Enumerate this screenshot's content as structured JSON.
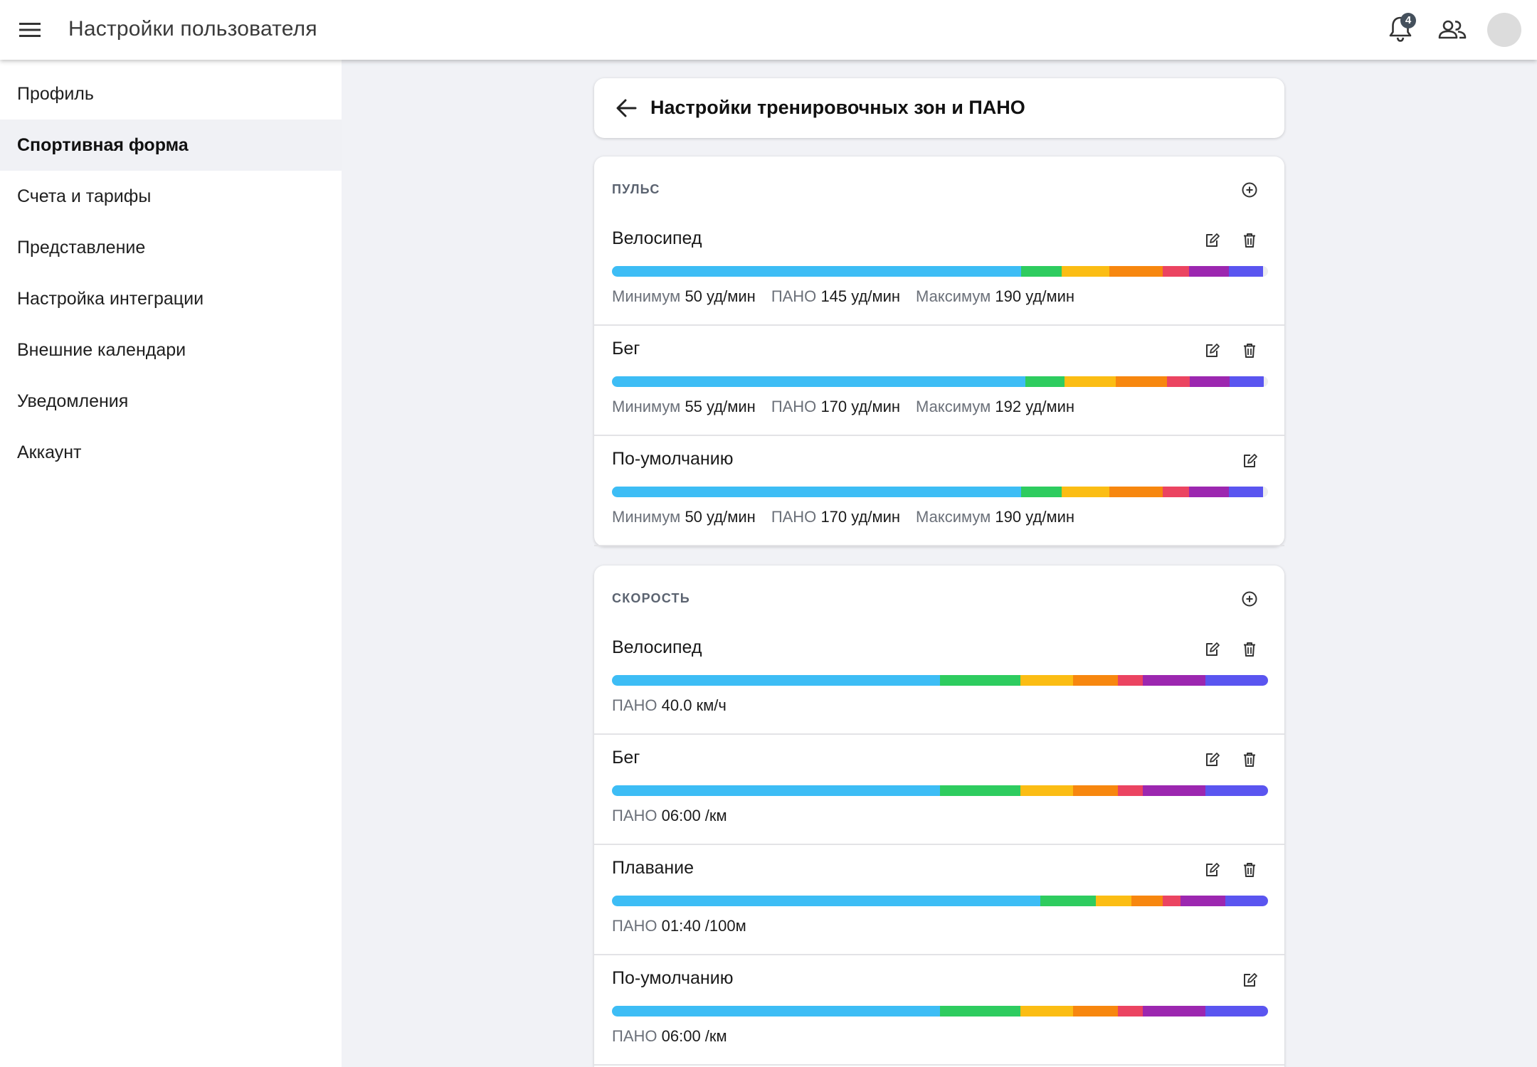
{
  "topbar": {
    "title": "Настройки пользователя",
    "notifications_count": "4"
  },
  "sidebar": {
    "items": [
      {
        "label": "Профиль",
        "active": false
      },
      {
        "label": "Спортивная форма",
        "active": true
      },
      {
        "label": "Счета и тарифы",
        "active": false
      },
      {
        "label": "Представление",
        "active": false
      },
      {
        "label": "Настройка интеграции",
        "active": false
      },
      {
        "label": "Внешние календари",
        "active": false
      },
      {
        "label": "Уведомления",
        "active": false
      },
      {
        "label": "Аккаунт",
        "active": false
      }
    ]
  },
  "page": {
    "title": "Настройки тренировочных зон и ПАНО"
  },
  "zone_colors": [
    "#3dbdf5",
    "#2ecc5f",
    "#fbbd14",
    "#f7870f",
    "#eb4461",
    "#9c27b0",
    "#5a55f0"
  ],
  "labels": {
    "min": "Минимум",
    "pano": "ПАНО",
    "max": "Максимум"
  },
  "pulse": {
    "title": "ПУЛЬС",
    "rows": [
      {
        "name": "Велосипед",
        "deletable": true,
        "min": "50 уд/мин",
        "pano": "145 уд/мин",
        "max": "190 уд/мин",
        "zones": [
          62.4,
          6.1,
          7.3,
          8.2,
          4.0,
          6.0,
          5.2
        ]
      },
      {
        "name": "Бег",
        "deletable": true,
        "min": "55 уд/мин",
        "pano": "170 уд/мин",
        "max": "192 уд/мин",
        "zones": [
          63.0,
          6.0,
          7.8,
          7.8,
          3.5,
          6.0,
          5.2
        ]
      },
      {
        "name": "По-умолчанию",
        "deletable": false,
        "min": "50 уд/мин",
        "pano": "170 уд/мин",
        "max": "190 уд/мин",
        "zones": [
          62.4,
          6.1,
          7.3,
          8.2,
          4.0,
          6.0,
          5.2
        ]
      }
    ]
  },
  "speed": {
    "title": "СКОРОСТЬ",
    "rows": [
      {
        "name": "Велосипед",
        "deletable": true,
        "pano": "40.0 км/ч",
        "zones": [
          50.0,
          12.3,
          8.0,
          6.8,
          3.8,
          9.6,
          9.5
        ]
      },
      {
        "name": "Бег",
        "deletable": true,
        "pano": "06:00 /км",
        "zones": [
          50.0,
          12.3,
          8.0,
          6.8,
          3.8,
          9.6,
          9.5
        ]
      },
      {
        "name": "Плавание",
        "deletable": true,
        "pano": "01:40 /100м",
        "zones": [
          65.3,
          8.4,
          5.5,
          4.8,
          2.7,
          6.8,
          6.5
        ]
      },
      {
        "name": "По-умолчанию",
        "deletable": false,
        "pano": "06:00 /км",
        "zones": [
          50.0,
          12.3,
          8.0,
          6.8,
          3.8,
          9.6,
          9.5
        ]
      }
    ]
  }
}
